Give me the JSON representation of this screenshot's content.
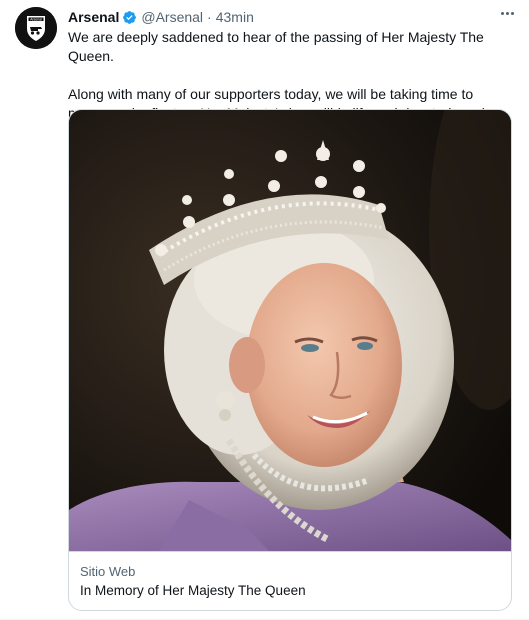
{
  "tweet": {
    "author_name": "Arsenal",
    "author_handle": "@Arsenal",
    "separator": "·",
    "timestamp": "43min",
    "verified": true,
    "avatar_icon": "arsenal-crest-icon",
    "avatar_label": "Arsenal",
    "more_icon": "ellipsis-icon",
    "text_paragraphs": [
      "We are deeply saddened to hear of the passing of Her Majesty The Queen.",
      "Along with many of our supporters today, we will be taking time to mourn and reflect on Her Majesty’s incredible life and devoted service."
    ]
  },
  "card": {
    "image_icon": "queen-portrait-image",
    "domain": "Sitio Web",
    "title": "In Memory of Her Majesty The Queen"
  },
  "colors": {
    "text_primary": "#0f1419",
    "text_secondary": "#536471",
    "verified_blue": "#1d9bf0",
    "border": "#cfd9de",
    "avatar_bg": "#111111"
  }
}
